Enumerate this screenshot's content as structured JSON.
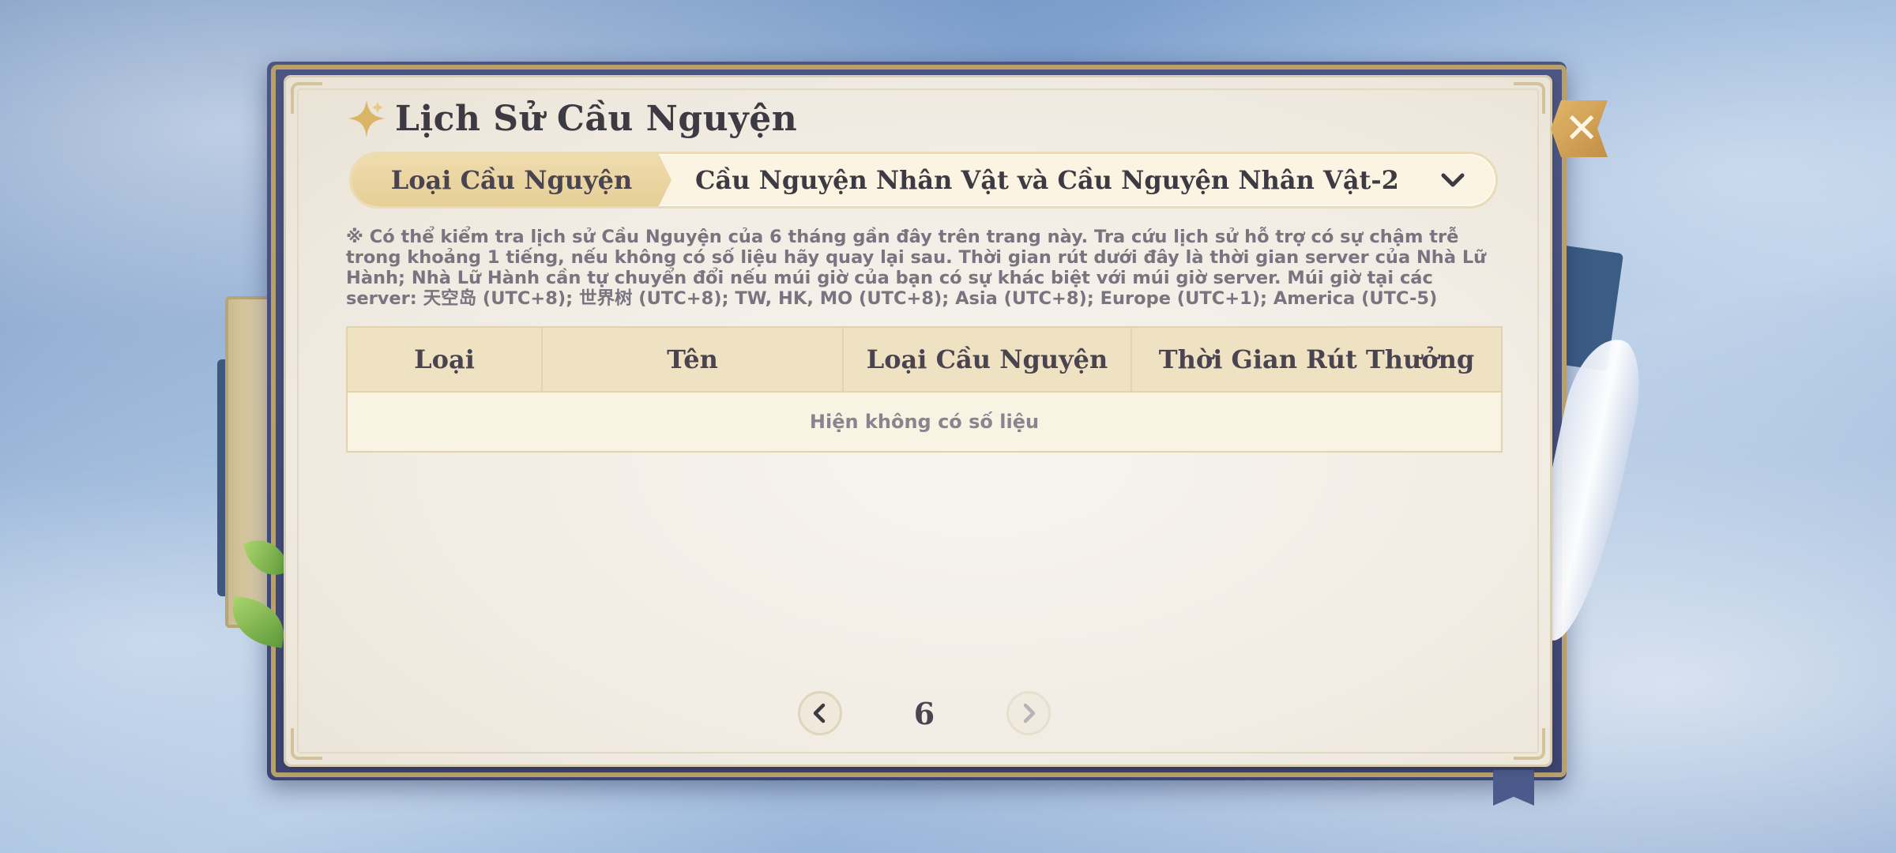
{
  "window": {
    "title": "Lịch Sử Cầu Nguyện",
    "close_icon": "close-icon"
  },
  "selector": {
    "label": "Loại Cầu Nguyện",
    "value": "Cầu Nguyện Nhân Vật và Cầu Nguyện Nhân Vật-2",
    "dropdown_icon": "chevron-down-icon"
  },
  "notice": {
    "text": "※ Có thể kiểm tra lịch sử Cầu Nguyện của 6 tháng gần đây trên trang này. Tra cứu lịch sử hỗ trợ có sự chậm trễ trong khoảng 1 tiếng, nếu không có số liệu hãy quay lại sau. Thời gian rút dưới đây là thời gian server của Nhà Lữ Hành; Nhà Lữ Hành cần tự chuyển đổi nếu múi giờ của bạn có sự khác biệt với múi giờ server. Múi giờ tại các server: 天空岛 (UTC+8); 世界树 (UTC+8); TW, HK, MO (UTC+8); Asia (UTC+8); Europe (UTC+1); America (UTC-5)"
  },
  "table": {
    "columns": [
      "Loại",
      "Tên",
      "Loại Cầu Nguyện",
      "Thời Gian Rút Thưởng"
    ],
    "empty_text": "Hiện không có số liệu"
  },
  "pager": {
    "current_page": "6",
    "prev_icon": "chevron-left-icon",
    "next_icon": "chevron-right-icon"
  },
  "colors": {
    "accent_gold": "#e6cf97",
    "text_dark": "#3d3a43",
    "parchment": "#f1ece3"
  }
}
